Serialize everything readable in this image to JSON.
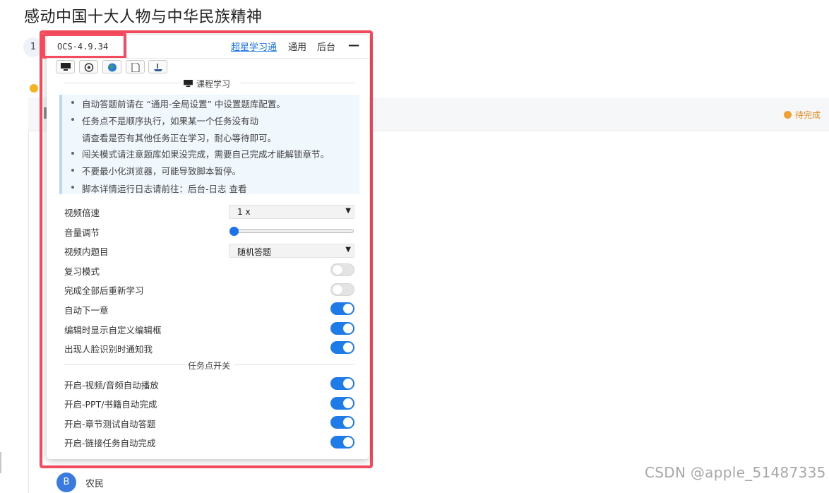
{
  "page": {
    "title": "感动中国十大人物与中华民族精神",
    "chapter_number": "1",
    "status_pending": "待完成",
    "user_initial": "B",
    "user_name": "农民",
    "watermark": "CSDN @apple_51487335"
  },
  "panel": {
    "version": "OCS-4.9.34",
    "nav": {
      "chaoxing": "超星学习通",
      "general": "通用",
      "backend": "后台"
    },
    "minimize_symbol": "—",
    "toolbar_icons": [
      "monitor-icon",
      "gear-icon",
      "globe-icon",
      "document-icon",
      "ship-icon"
    ],
    "section_course": "课程学习",
    "notices": [
      "自动答题前请在 “通用-全局设置” 中设置题库配置。",
      "任务点不是顺序执行，如果某一个任务没有动",
      "请查看是否有其他任务正在学习，耐心等待即可。",
      "闯关模式请注意题库如果没完成，需要自己完成才能解锁章节。",
      "不要最小化浏览器，可能导致脚本暂停。",
      "脚本详情运行日志请前往：后台-日志 查看"
    ],
    "settings": {
      "video_speed_label": "视频倍速",
      "video_speed_value": "1 x",
      "volume_label": "音量调节",
      "volume_value": 0,
      "video_question_label": "视频内题目",
      "video_question_value": "随机答题",
      "review_mode_label": "复习模式",
      "review_mode_on": false,
      "relearn_label": "完成全部后重新学习",
      "relearn_on": false,
      "auto_next_label": "自动下一章",
      "auto_next_on": true,
      "custom_editor_label": "编辑时显示自定义编辑框",
      "custom_editor_on": true,
      "face_notify_label": "出现人脸识别时通知我",
      "face_notify_on": true
    },
    "section_tasks": "任务点开关",
    "tasks": {
      "video_label": "开启-视频/音频自动播放",
      "video_on": true,
      "ppt_label": "开启-PPT/书籍自动完成",
      "ppt_on": true,
      "test_label": "开启-章节测试自动答题",
      "test_on": true,
      "link_label": "开启-链接任务自动完成",
      "link_on": true
    }
  },
  "colors": {
    "accent": "#1e7be8",
    "highlight": "#f44b5f",
    "pending": "#e08a1e"
  }
}
